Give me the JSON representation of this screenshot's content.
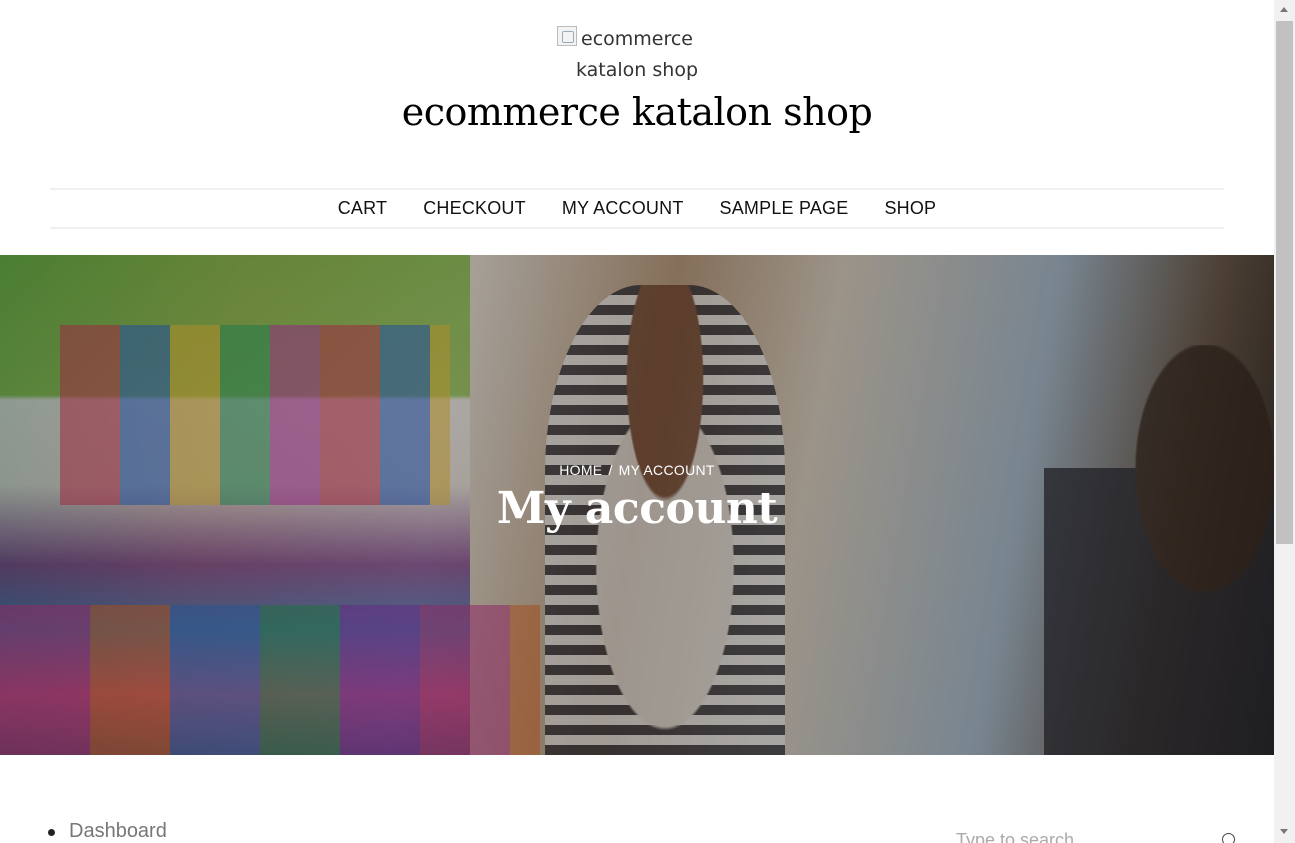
{
  "header": {
    "logo_alt": "ecommerce katalon shop",
    "site_title": "ecommerce katalon shop"
  },
  "nav": {
    "items": [
      {
        "label": "CART"
      },
      {
        "label": "CHECKOUT"
      },
      {
        "label": "MY ACCOUNT"
      },
      {
        "label": "SAMPLE PAGE"
      },
      {
        "label": "SHOP"
      }
    ]
  },
  "hero": {
    "breadcrumb": {
      "home": "HOME",
      "separator": "/",
      "current": "MY ACCOUNT"
    },
    "title": "My account"
  },
  "account_nav": {
    "items": [
      {
        "label": "Dashboard"
      }
    ]
  },
  "search": {
    "placeholder": "Type to search"
  },
  "colors": {
    "text": "#111111",
    "muted": "#777777",
    "hero_text": "#ffffff",
    "nav_border": "#f0f0f0"
  },
  "icons": {
    "search": "search-icon",
    "logo": "broken-image-icon"
  }
}
